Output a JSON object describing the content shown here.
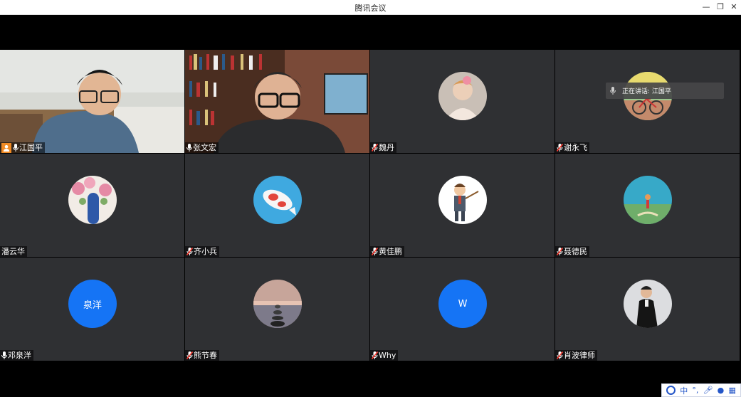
{
  "window": {
    "title": "腾讯会议",
    "controls": [
      "minimize",
      "restore",
      "close"
    ]
  },
  "participants": [
    {
      "name": "江国平",
      "type": "video",
      "host": true,
      "active": true,
      "mic": "on"
    },
    {
      "name": "张文宏",
      "type": "video",
      "host": false,
      "active": false,
      "mic": "on"
    },
    {
      "name": "魏丹",
      "type": "avatar",
      "avatar": "girl-photo",
      "mic": "muted"
    },
    {
      "name": "谢永飞",
      "type": "avatar",
      "avatar": "bicycle-photo",
      "mic": "muted"
    },
    {
      "name": "潘云华",
      "type": "avatar",
      "avatar": "flower-door-photo",
      "mic": "none"
    },
    {
      "name": "齐小兵",
      "type": "avatar",
      "avatar": "koi-fish-art",
      "mic": "muted"
    },
    {
      "name": "黄佳鹏",
      "type": "avatar",
      "avatar": "teacher-cartoon",
      "mic": "muted"
    },
    {
      "name": "聂德民",
      "type": "avatar",
      "avatar": "beach-photo",
      "mic": "muted"
    },
    {
      "name": "邓泉洋",
      "type": "text-avatar",
      "initials": "泉洋",
      "mic": "on"
    },
    {
      "name": "熊节春",
      "type": "avatar",
      "avatar": "sea-stones-photo",
      "mic": "muted"
    },
    {
      "name": "Why",
      "type": "text-avatar",
      "initials": "W",
      "mic": "muted"
    },
    {
      "name": "肖波律师",
      "type": "avatar",
      "avatar": "man-suit-photo",
      "mic": "muted"
    }
  ],
  "speaking_indicator": {
    "label": "正在讲话: 江国平"
  },
  "ime_toolbar": {
    "lang": "中"
  },
  "colors": {
    "accent": "#1574f5",
    "active_border": "#3ee07a",
    "host_badge": "#f08a24",
    "tile_bg": "#2f3033"
  }
}
